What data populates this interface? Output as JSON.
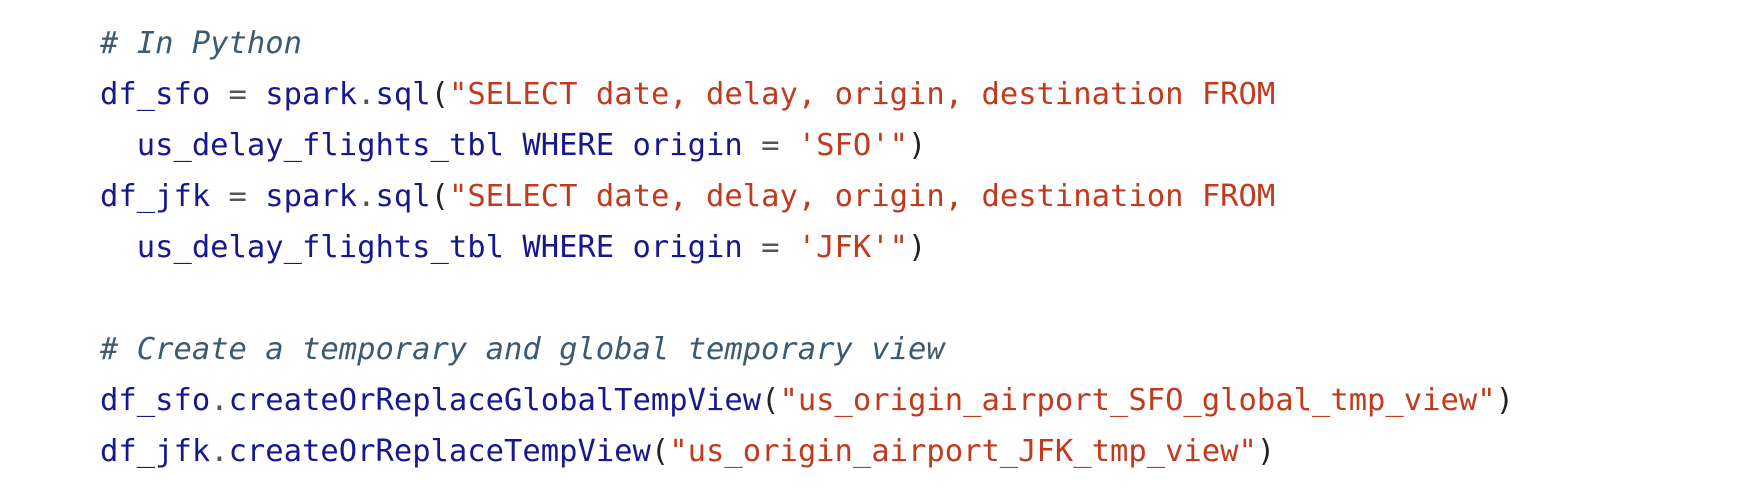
{
  "code": {
    "lines": [
      [
        {
          "t": "# In Python",
          "k": "comment"
        }
      ],
      [
        {
          "t": "df_sfo",
          "k": "ident"
        },
        {
          "t": " = ",
          "k": "op"
        },
        {
          "t": "spark",
          "k": "ident"
        },
        {
          "t": ".",
          "k": "op"
        },
        {
          "t": "sql",
          "k": "ident"
        },
        {
          "t": "(",
          "k": "punct"
        },
        {
          "t": "\"SELECT date, delay, origin, destination FROM",
          "k": "str"
        }
      ],
      [
        {
          "t": "  us_delay_flights_tbl WHERE origin",
          "k": "ident"
        },
        {
          "t": " = ",
          "k": "op"
        },
        {
          "t": "'SFO'\"",
          "k": "str"
        },
        {
          "t": ")",
          "k": "punct"
        }
      ],
      [
        {
          "t": "df_jfk",
          "k": "ident"
        },
        {
          "t": " = ",
          "k": "op"
        },
        {
          "t": "spark",
          "k": "ident"
        },
        {
          "t": ".",
          "k": "op"
        },
        {
          "t": "sql",
          "k": "ident"
        },
        {
          "t": "(",
          "k": "punct"
        },
        {
          "t": "\"SELECT date, delay, origin, destination FROM",
          "k": "str"
        }
      ],
      [
        {
          "t": "  us_delay_flights_tbl WHERE origin",
          "k": "ident"
        },
        {
          "t": " = ",
          "k": "op"
        },
        {
          "t": "'JFK'\"",
          "k": "str"
        },
        {
          "t": ")",
          "k": "punct"
        }
      ],
      [],
      [
        {
          "t": "# Create a temporary and global temporary view",
          "k": "comment"
        }
      ],
      [
        {
          "t": "df_sfo",
          "k": "ident"
        },
        {
          "t": ".",
          "k": "op"
        },
        {
          "t": "createOrReplaceGlobalTempView",
          "k": "ident"
        },
        {
          "t": "(",
          "k": "punct"
        },
        {
          "t": "\"us_origin_airport_SFO_global_tmp_view\"",
          "k": "str"
        },
        {
          "t": ")",
          "k": "punct"
        }
      ],
      [
        {
          "t": "df_jfk",
          "k": "ident"
        },
        {
          "t": ".",
          "k": "op"
        },
        {
          "t": "createOrReplaceTempView",
          "k": "ident"
        },
        {
          "t": "(",
          "k": "punct"
        },
        {
          "t": "\"us_origin_airport_JFK_tmp_view\"",
          "k": "str"
        },
        {
          "t": ")",
          "k": "punct"
        }
      ]
    ]
  },
  "colors": {
    "comment": "#3c5a70",
    "identifier": "#16188f",
    "string": "#c23a1d",
    "operator": "#555555",
    "background": "#ffffff"
  }
}
